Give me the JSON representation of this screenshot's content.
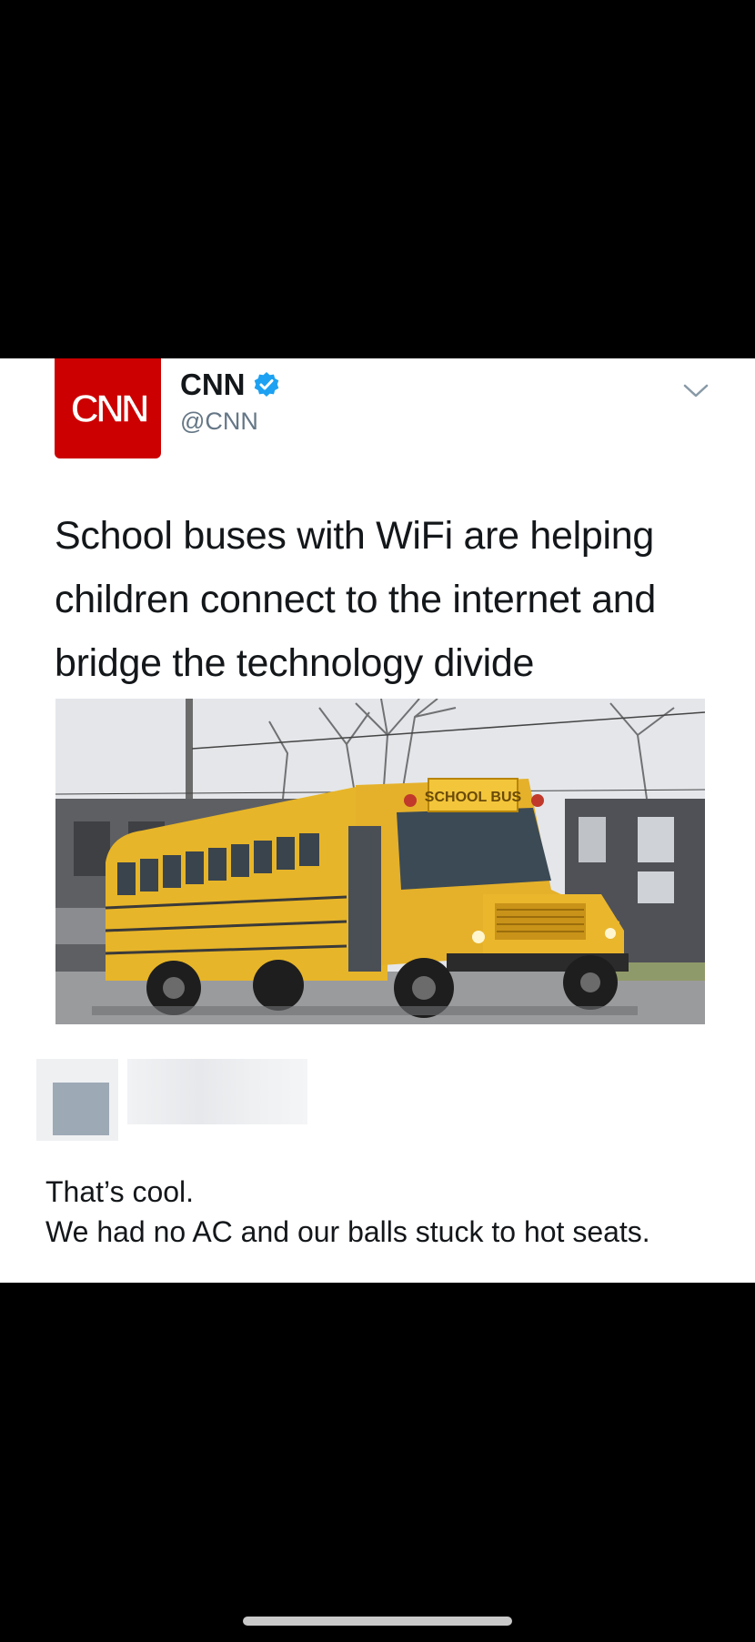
{
  "tweet": {
    "logo_text": "CNN",
    "account_name": "CNN",
    "verified_icon": "verified-badge-icon",
    "handle": "@CNN",
    "menu_icon": "chevron-down-icon",
    "text": "School buses with WiFi are helping children connect to the internet and bridge the technology divide",
    "image": {
      "icon": "school-bus-photo",
      "sign_text": "SCHOOL BUS"
    }
  },
  "reply": {
    "lines": [
      "That’s cool.",
      "We had no AC and our balls stuck to hot seats."
    ]
  },
  "colors": {
    "background": "#000000",
    "card": "#ffffff",
    "cnn_red": "#cc0000",
    "verified_blue": "#1da1f2",
    "text": "#14171a",
    "muted": "#657786"
  }
}
